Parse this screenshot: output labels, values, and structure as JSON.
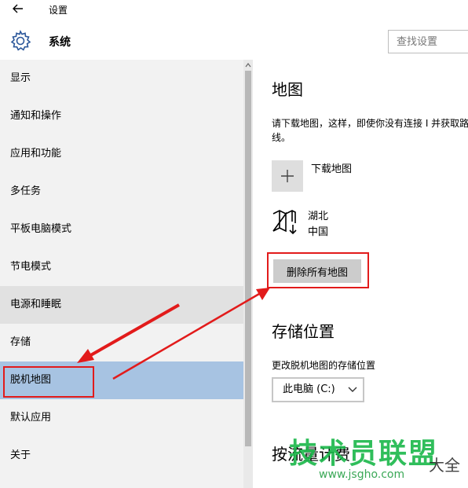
{
  "window": {
    "title": "设置"
  },
  "header": {
    "section": "系统",
    "search_placeholder": "查找设置"
  },
  "sidebar": {
    "items": [
      {
        "label": "显示"
      },
      {
        "label": "通知和操作"
      },
      {
        "label": "应用和功能"
      },
      {
        "label": "多任务"
      },
      {
        "label": "平板电脑模式"
      },
      {
        "label": "节电模式"
      },
      {
        "label": "电源和睡眠"
      },
      {
        "label": "存储"
      },
      {
        "label": "脱机地图"
      },
      {
        "label": "默认应用"
      },
      {
        "label": "关于"
      }
    ],
    "selected": "脱机地图",
    "hover": "电源和睡眠"
  },
  "maps": {
    "title": "地图",
    "description": "请下载地图，这样，即使你没有连接 I 并获取路线。",
    "download_label": "下载地图",
    "region": {
      "name": "湖北",
      "country": "中国"
    },
    "delete_all_label": "删除所有地图"
  },
  "storage": {
    "title": "存储位置",
    "change_label": "更改脱机地图的存储位置",
    "drive_value": "此电脑 (C:)"
  },
  "next_section": {
    "title": "按流量计费"
  },
  "watermark": {
    "brand": "技术员联盟",
    "url": "www.jsgho.com",
    "tail": "大全"
  },
  "colors": {
    "selected": "#a7c3e2",
    "hover": "#e1e1e1",
    "highlight": "#e21b1b",
    "sidebar_bg": "#f2f2f2"
  }
}
